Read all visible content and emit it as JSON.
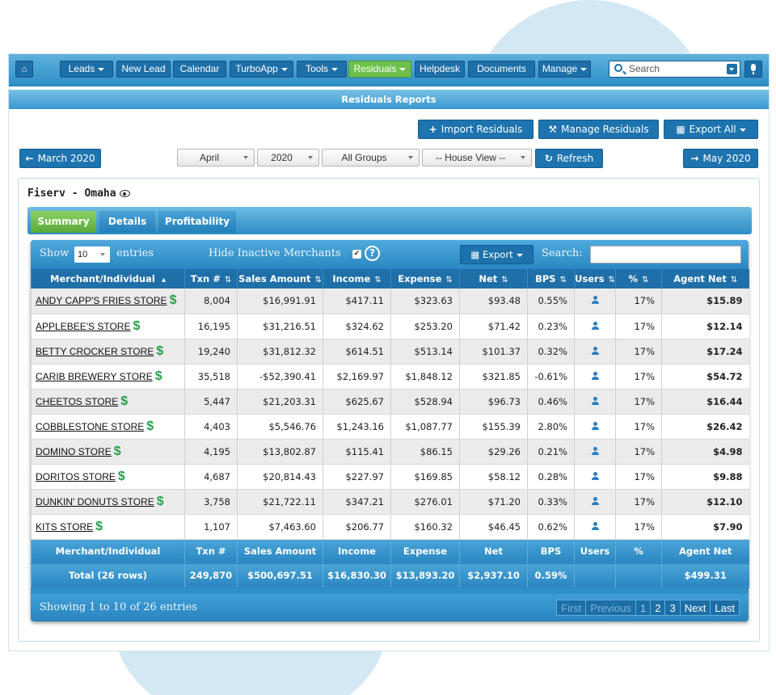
{
  "nav": {
    "items": [
      {
        "label": "Leads",
        "caret": true
      },
      {
        "label": "New Lead",
        "caret": false
      },
      {
        "label": "Calendar",
        "caret": false
      },
      {
        "label": "TurboApp",
        "caret": true
      },
      {
        "label": "Tools",
        "caret": true
      },
      {
        "label": "Residuals",
        "caret": true,
        "active": true
      },
      {
        "label": "Helpdesk",
        "caret": false
      },
      {
        "label": "Documents",
        "caret": false
      },
      {
        "label": "Manage",
        "caret": true
      }
    ],
    "search_placeholder": "Search",
    "icons": {
      "home": "home-icon",
      "search": "search-icon",
      "mic": "microphone-icon"
    }
  },
  "page_title": "Residuals Reports",
  "actions": {
    "import": "Import Residuals",
    "manage": "Manage Residuals",
    "export_all": "Export All"
  },
  "period": {
    "prev": "March 2020",
    "next": "May 2020",
    "month": "April",
    "year": "2020",
    "group": "All Groups",
    "view": "-- House View --",
    "refresh": "Refresh"
  },
  "merchant_title": "Fiserv - Omaha",
  "tabs": [
    "Summary",
    "Details",
    "Profitability"
  ],
  "grid": {
    "show_label": "Show",
    "entries_value": "10",
    "entries_label": "entries",
    "hide_inactive": "Hide Inactive Merchants",
    "hide_checked": "✓",
    "export_label": "Export",
    "search_label": "Search:",
    "columns": [
      "Merchant/Individual",
      "Txn #",
      "Sales Amount",
      "Income",
      "Expense",
      "Net",
      "BPS",
      "Users",
      "%",
      "Agent Net"
    ],
    "rows": [
      {
        "name": "ANDY CAPP'S FRIES STORE",
        "txn": "8,004",
        "sales": "$16,991.91",
        "income": "$417.11",
        "expense": "$323.63",
        "net": "$93.48",
        "bps": "0.55%",
        "pct": "17%",
        "agent": "$15.89"
      },
      {
        "name": "APPLEBEE'S STORE",
        "txn": "16,195",
        "sales": "$31,216.51",
        "income": "$324.62",
        "expense": "$253.20",
        "net": "$71.42",
        "bps": "0.23%",
        "pct": "17%",
        "agent": "$12.14"
      },
      {
        "name": "BETTY CROCKER STORE",
        "txn": "19,240",
        "sales": "$31,812.32",
        "income": "$614.51",
        "expense": "$513.14",
        "net": "$101.37",
        "bps": "0.32%",
        "pct": "17%",
        "agent": "$17.24"
      },
      {
        "name": "CARIB BREWERY STORE",
        "txn": "35,518",
        "sales": "-$52,390.41",
        "income": "$2,169.97",
        "expense": "$1,848.12",
        "net": "$321.85",
        "bps": "-0.61%",
        "pct": "17%",
        "agent": "$54.72"
      },
      {
        "name": "CHEETOS STORE",
        "txn": "5,447",
        "sales": "$21,203.31",
        "income": "$625.67",
        "expense": "$528.94",
        "net": "$96.73",
        "bps": "0.46%",
        "pct": "17%",
        "agent": "$16.44"
      },
      {
        "name": "COBBLESTONE STORE",
        "txn": "4,403",
        "sales": "$5,546.76",
        "income": "$1,243.16",
        "expense": "$1,087.77",
        "net": "$155.39",
        "bps": "2.80%",
        "pct": "17%",
        "agent": "$26.42"
      },
      {
        "name": "DOMINO STORE",
        "txn": "4,195",
        "sales": "$13,802.87",
        "income": "$115.41",
        "expense": "$86.15",
        "net": "$29.26",
        "bps": "0.21%",
        "pct": "17%",
        "agent": "$4.98"
      },
      {
        "name": "DORITOS STORE",
        "txn": "4,687",
        "sales": "$20,814.43",
        "income": "$227.97",
        "expense": "$169.85",
        "net": "$58.12",
        "bps": "0.28%",
        "pct": "17%",
        "agent": "$9.88"
      },
      {
        "name": "DUNKIN' DONUTS STORE",
        "txn": "3,758",
        "sales": "$21,722.11",
        "income": "$347.21",
        "expense": "$276.01",
        "net": "$71.20",
        "bps": "0.33%",
        "pct": "17%",
        "agent": "$12.10"
      },
      {
        "name": "KITS STORE",
        "txn": "1,107",
        "sales": "$7,463.60",
        "income": "$206.77",
        "expense": "$160.32",
        "net": "$46.45",
        "bps": "0.62%",
        "pct": "17%",
        "agent": "$7.90"
      }
    ],
    "total": {
      "label": "Total (26 rows)",
      "txn": "249,870",
      "sales": "$500,697.51",
      "income": "$16,830.30",
      "expense": "$13,893.20",
      "net": "$2,937.10",
      "bps": "0.59%",
      "users": "",
      "pct": "",
      "agent": "$499.31"
    },
    "showing": "Showing 1 to 10 of 26 entries",
    "pager": {
      "first": "First",
      "previous": "Previous",
      "pages": [
        "1",
        "2",
        "3"
      ],
      "next": "Next",
      "last": "Last"
    }
  },
  "colors": {
    "accent": "#2e8ec6",
    "active_green": "#6dc04a",
    "dollar_green": "#24a24a"
  }
}
